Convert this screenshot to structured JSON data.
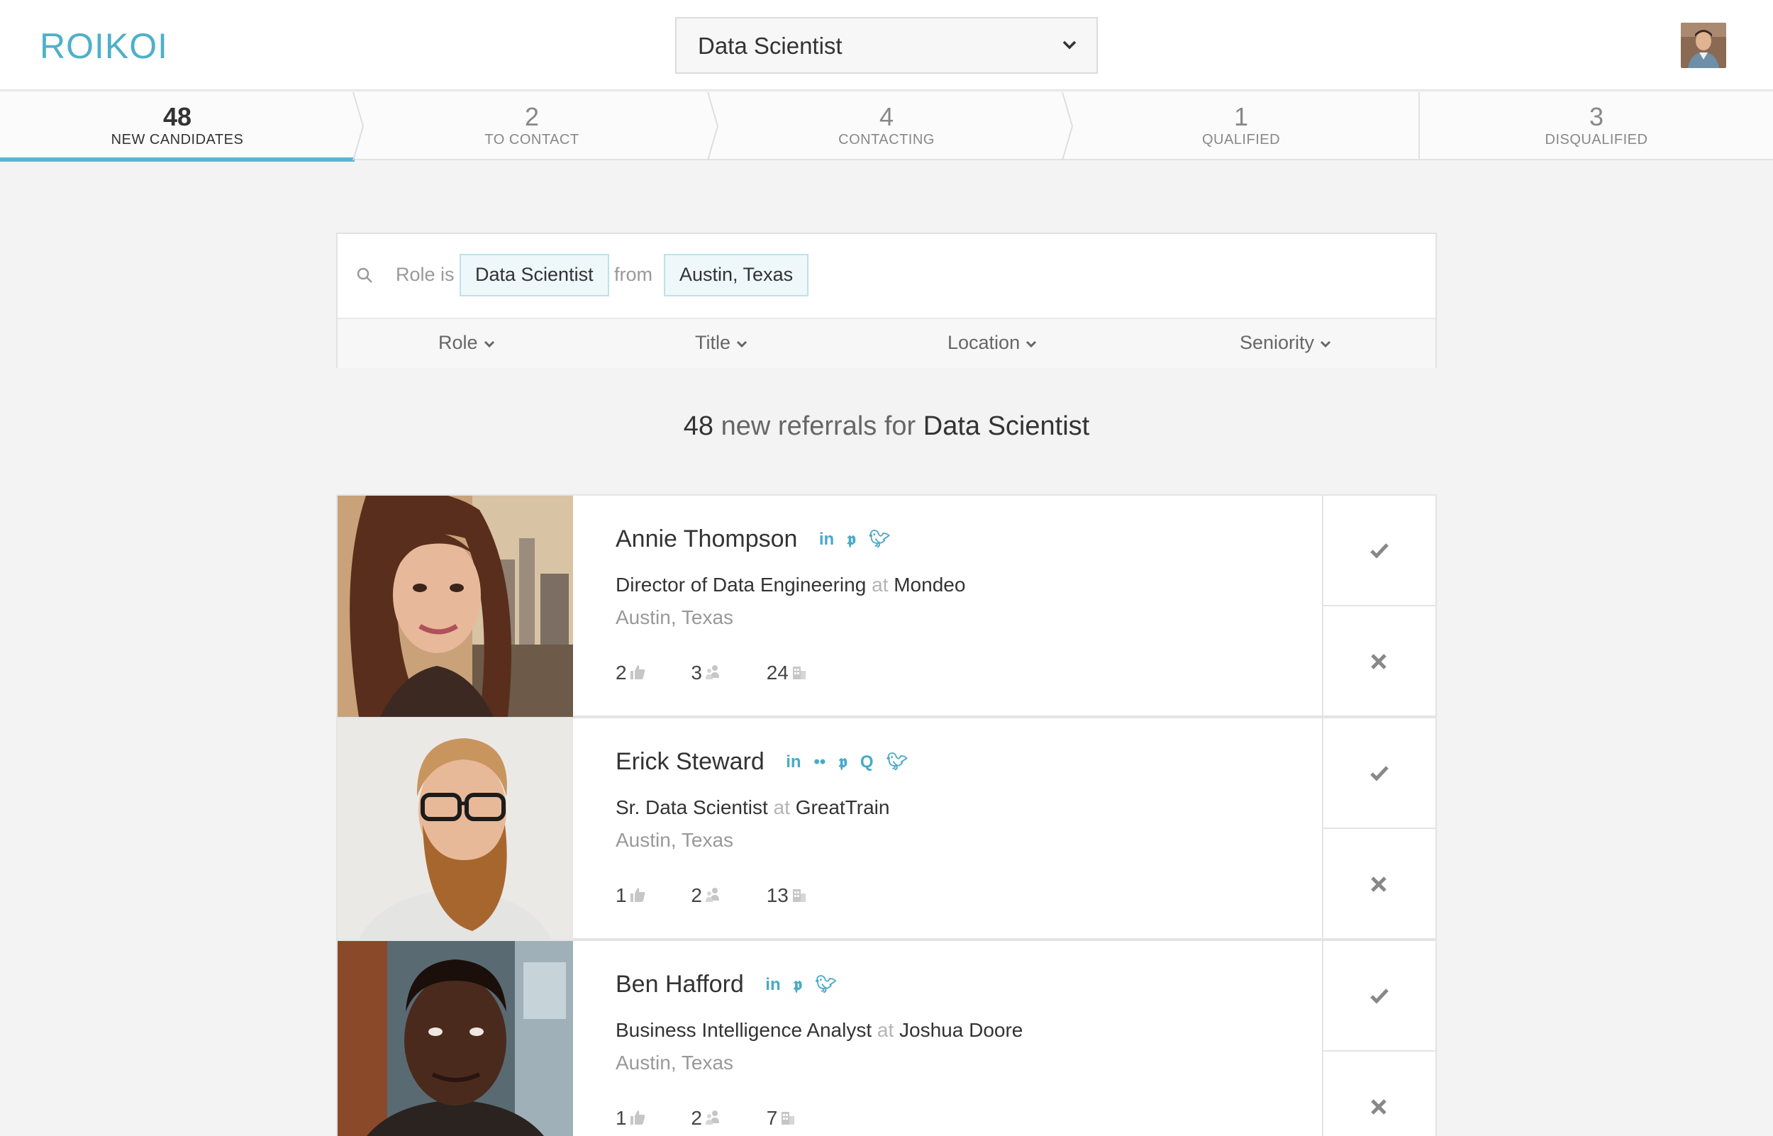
{
  "app": {
    "logo": "ROIKOI"
  },
  "header": {
    "role_select": "Data Scientist"
  },
  "pipeline": [
    {
      "count": "48",
      "label": "NEW CANDIDATES"
    },
    {
      "count": "2",
      "label": "TO CONTACT"
    },
    {
      "count": "4",
      "label": "CONTACTING"
    },
    {
      "count": "1",
      "label": "QUALIFIED"
    },
    {
      "count": "3",
      "label": "DISQUALIFIED"
    }
  ],
  "filter": {
    "role_prefix": "Role is",
    "role_chip": "Data Scientist",
    "from_word": "from",
    "location_chip": "Austin, Texas",
    "sorts": [
      "Role",
      "Title",
      "Location",
      "Seniority"
    ]
  },
  "summary": {
    "count": "48",
    "middle": "new referrals for",
    "role": "Data Scientist"
  },
  "candidates": [
    {
      "name": "Annie Thompson",
      "socials": [
        "linkedin",
        "pinterest",
        "twitter"
      ],
      "title": "Director of Data Engineering",
      "at": "at",
      "company": "Mondeo",
      "location": "Austin, Texas",
      "stats": {
        "endorsements": "2",
        "connections": "3",
        "companies": "24"
      }
    },
    {
      "name": "Erick Steward",
      "socials": [
        "linkedin",
        "flickr",
        "pinterest",
        "quora",
        "twitter"
      ],
      "title": "Sr. Data Scientist",
      "at": "at",
      "company": "GreatTrain",
      "location": "Austin, Texas",
      "stats": {
        "endorsements": "1",
        "connections": "2",
        "companies": "13"
      }
    },
    {
      "name": "Ben Hafford",
      "socials": [
        "linkedin",
        "pinterest",
        "twitter"
      ],
      "title": "Business Intelligence Analyst",
      "at": "at",
      "company": "Joshua Doore",
      "location": "Austin, Texas",
      "stats": {
        "endorsements": "1",
        "connections": "2",
        "companies": "7"
      }
    }
  ],
  "colors": {
    "accent": "#4fb0c9",
    "chip_bg": "#eef7fa"
  }
}
